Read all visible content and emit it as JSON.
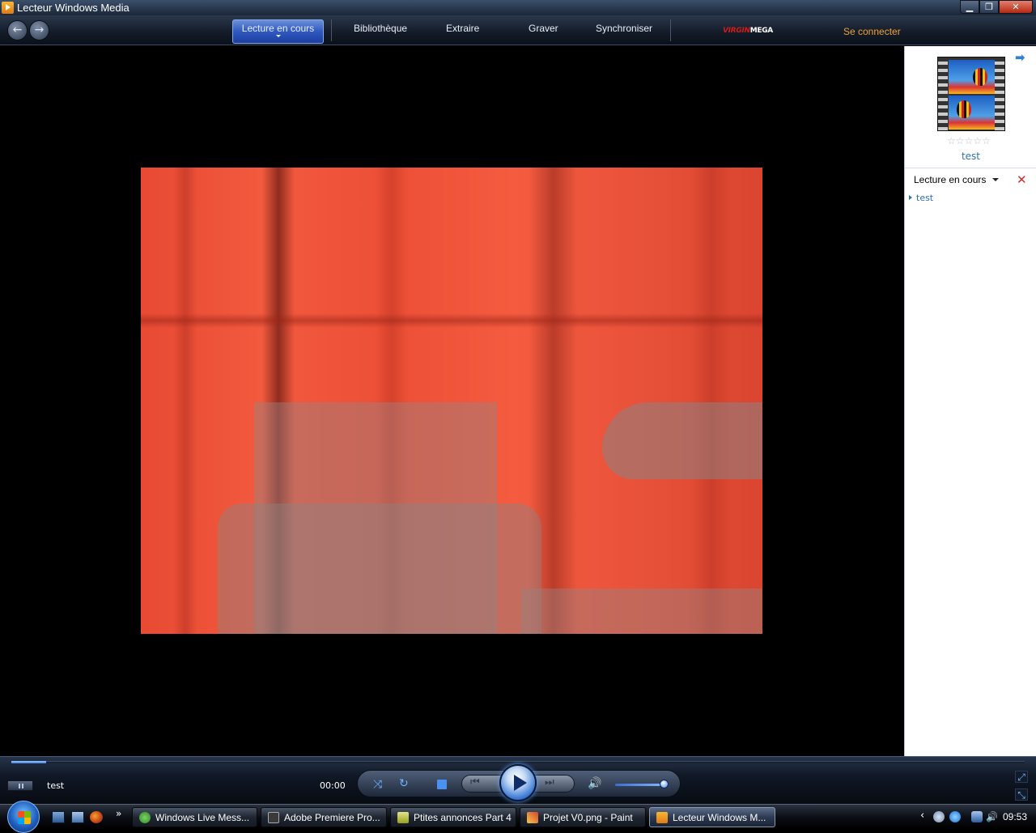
{
  "window": {
    "title": "Lecteur Windows Media",
    "buttons": {
      "minimize": "▁",
      "maximize": "❐",
      "close": "✕"
    }
  },
  "nav": {
    "back_glyph": "←",
    "forward_glyph": "→",
    "tabs": [
      {
        "label": "Lecture en cours",
        "active": true
      },
      {
        "label": "Bibliothèque"
      },
      {
        "label": "Extraire"
      },
      {
        "label": "Graver"
      },
      {
        "label": "Synchroniser"
      }
    ],
    "brand": {
      "part1": "VIRGIN",
      "part2": "MEGA"
    },
    "connect_label": "Se connecter"
  },
  "pane": {
    "arrow_glyph": "➡",
    "stars": "☆☆☆☆☆",
    "thumb_title": "test",
    "playlist_title": "Lecture en cours",
    "clear_glyph": "✕",
    "items": [
      {
        "label": "test"
      }
    ]
  },
  "transport": {
    "seek_progress": 0.034,
    "now_playing": "test",
    "time": "00:00",
    "shuffle_glyph": "⤨",
    "repeat_glyph": "↻",
    "prev_glyph": "⏮",
    "next_glyph": "⏭",
    "volume_glyph": "🔊",
    "volume_level": 0.9,
    "mini_a_glyph": "⤢",
    "mini_b_glyph": "⤡"
  },
  "taskbar": {
    "quicklaunch_more": "»",
    "tasks": [
      {
        "label": "Windows Live Mess..."
      },
      {
        "label": "Adobe Premiere Pro..."
      },
      {
        "label": "Ptites annonces Part 4"
      },
      {
        "label": "Projet V0.png - Paint"
      },
      {
        "label": "Lecteur Windows M...",
        "active": true
      }
    ],
    "tray_arrow": "‹",
    "volume_glyph": "🔊",
    "clock": "09:53"
  }
}
